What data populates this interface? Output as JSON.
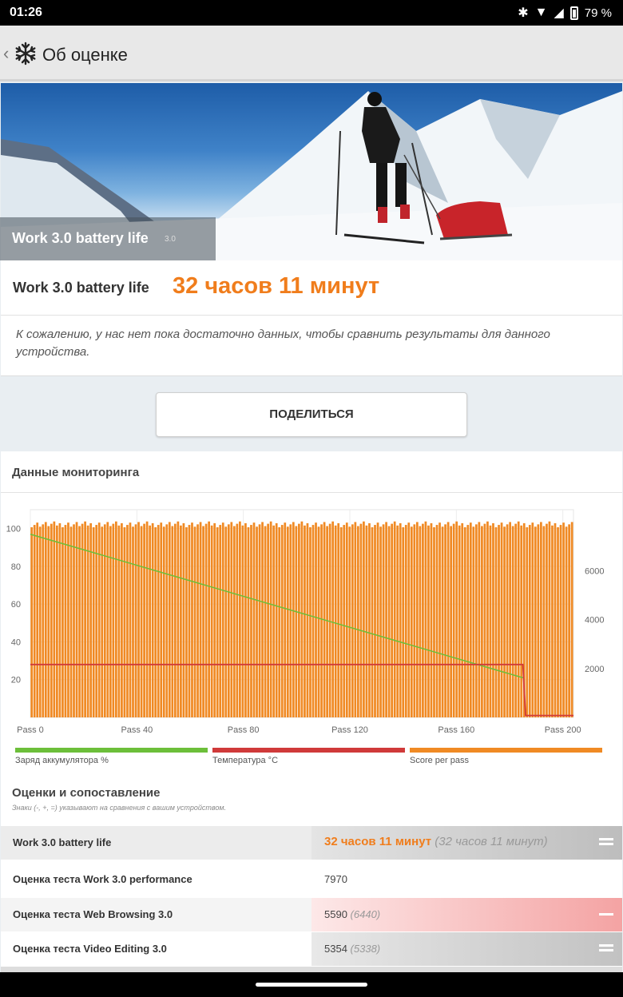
{
  "status": {
    "time": "01:26",
    "battery": "79 %"
  },
  "app": {
    "title": "Об оценке"
  },
  "hero": {
    "title": "Work 3.0 battery life",
    "version": "3.0"
  },
  "result": {
    "label": "Work 3.0 battery life",
    "value": "32 часов 11 минут",
    "note": "К сожалению, у нас нет пока достаточно данных, чтобы сравнить результаты для данного устройства."
  },
  "share": {
    "label": "ПОДЕЛИТЬСЯ"
  },
  "monitoring": {
    "title": "Данные мониторинга",
    "legend": [
      {
        "label": "Заряд аккумулятора %",
        "color": "#6cbf3a"
      },
      {
        "label": "Температура °C",
        "color": "#d03a3a"
      },
      {
        "label": "Score per pass",
        "color": "#f08a24"
      }
    ]
  },
  "chart_data": {
    "type": "bar",
    "x_ticks": [
      "Pass 0",
      "Pass 40",
      "Pass 80",
      "Pass 120",
      "Pass 160",
      "Pass 200"
    ],
    "y_left_ticks": [
      "20",
      "40",
      "60",
      "80",
      "100"
    ],
    "y_right_ticks": [
      "2000",
      "4000",
      "6000"
    ],
    "y_left_range": [
      0,
      110
    ],
    "y_right_range": [
      0,
      8500
    ],
    "passes": 193,
    "score_per_pass_approx": 7900,
    "battery_series": {
      "name": "Заряд аккумулятора %",
      "points": [
        [
          0,
          97
        ],
        [
          185,
          21
        ]
      ]
    },
    "temperature_series": {
      "name": "Температура °C",
      "points": [
        [
          0,
          28
        ],
        [
          185,
          28
        ],
        [
          186,
          1
        ],
        [
          204,
          1
        ]
      ]
    },
    "grid": true
  },
  "compare": {
    "title": "Оценки и сопоставление",
    "subtitle": "Знаки (-, +, =) указывают на сравнения с вашим устройством.",
    "rows": [
      {
        "name": "Work 3.0 battery life",
        "value": "32 часов 11 минут",
        "compare": "(32 часов 11 минут)",
        "mark": "=",
        "highlight": true
      },
      {
        "name": "Оценка теста Work 3.0 performance",
        "value": "7970",
        "compare": "",
        "mark": "",
        "highlight": false
      },
      {
        "name": "Оценка теста Web Browsing 3.0",
        "value": "5590",
        "compare": "(6440)",
        "mark": "-",
        "highlight": false
      },
      {
        "name": "Оценка теста Video Editing 3.0",
        "value": "5354",
        "compare": "(5338)",
        "mark": "=",
        "highlight": false
      }
    ]
  }
}
